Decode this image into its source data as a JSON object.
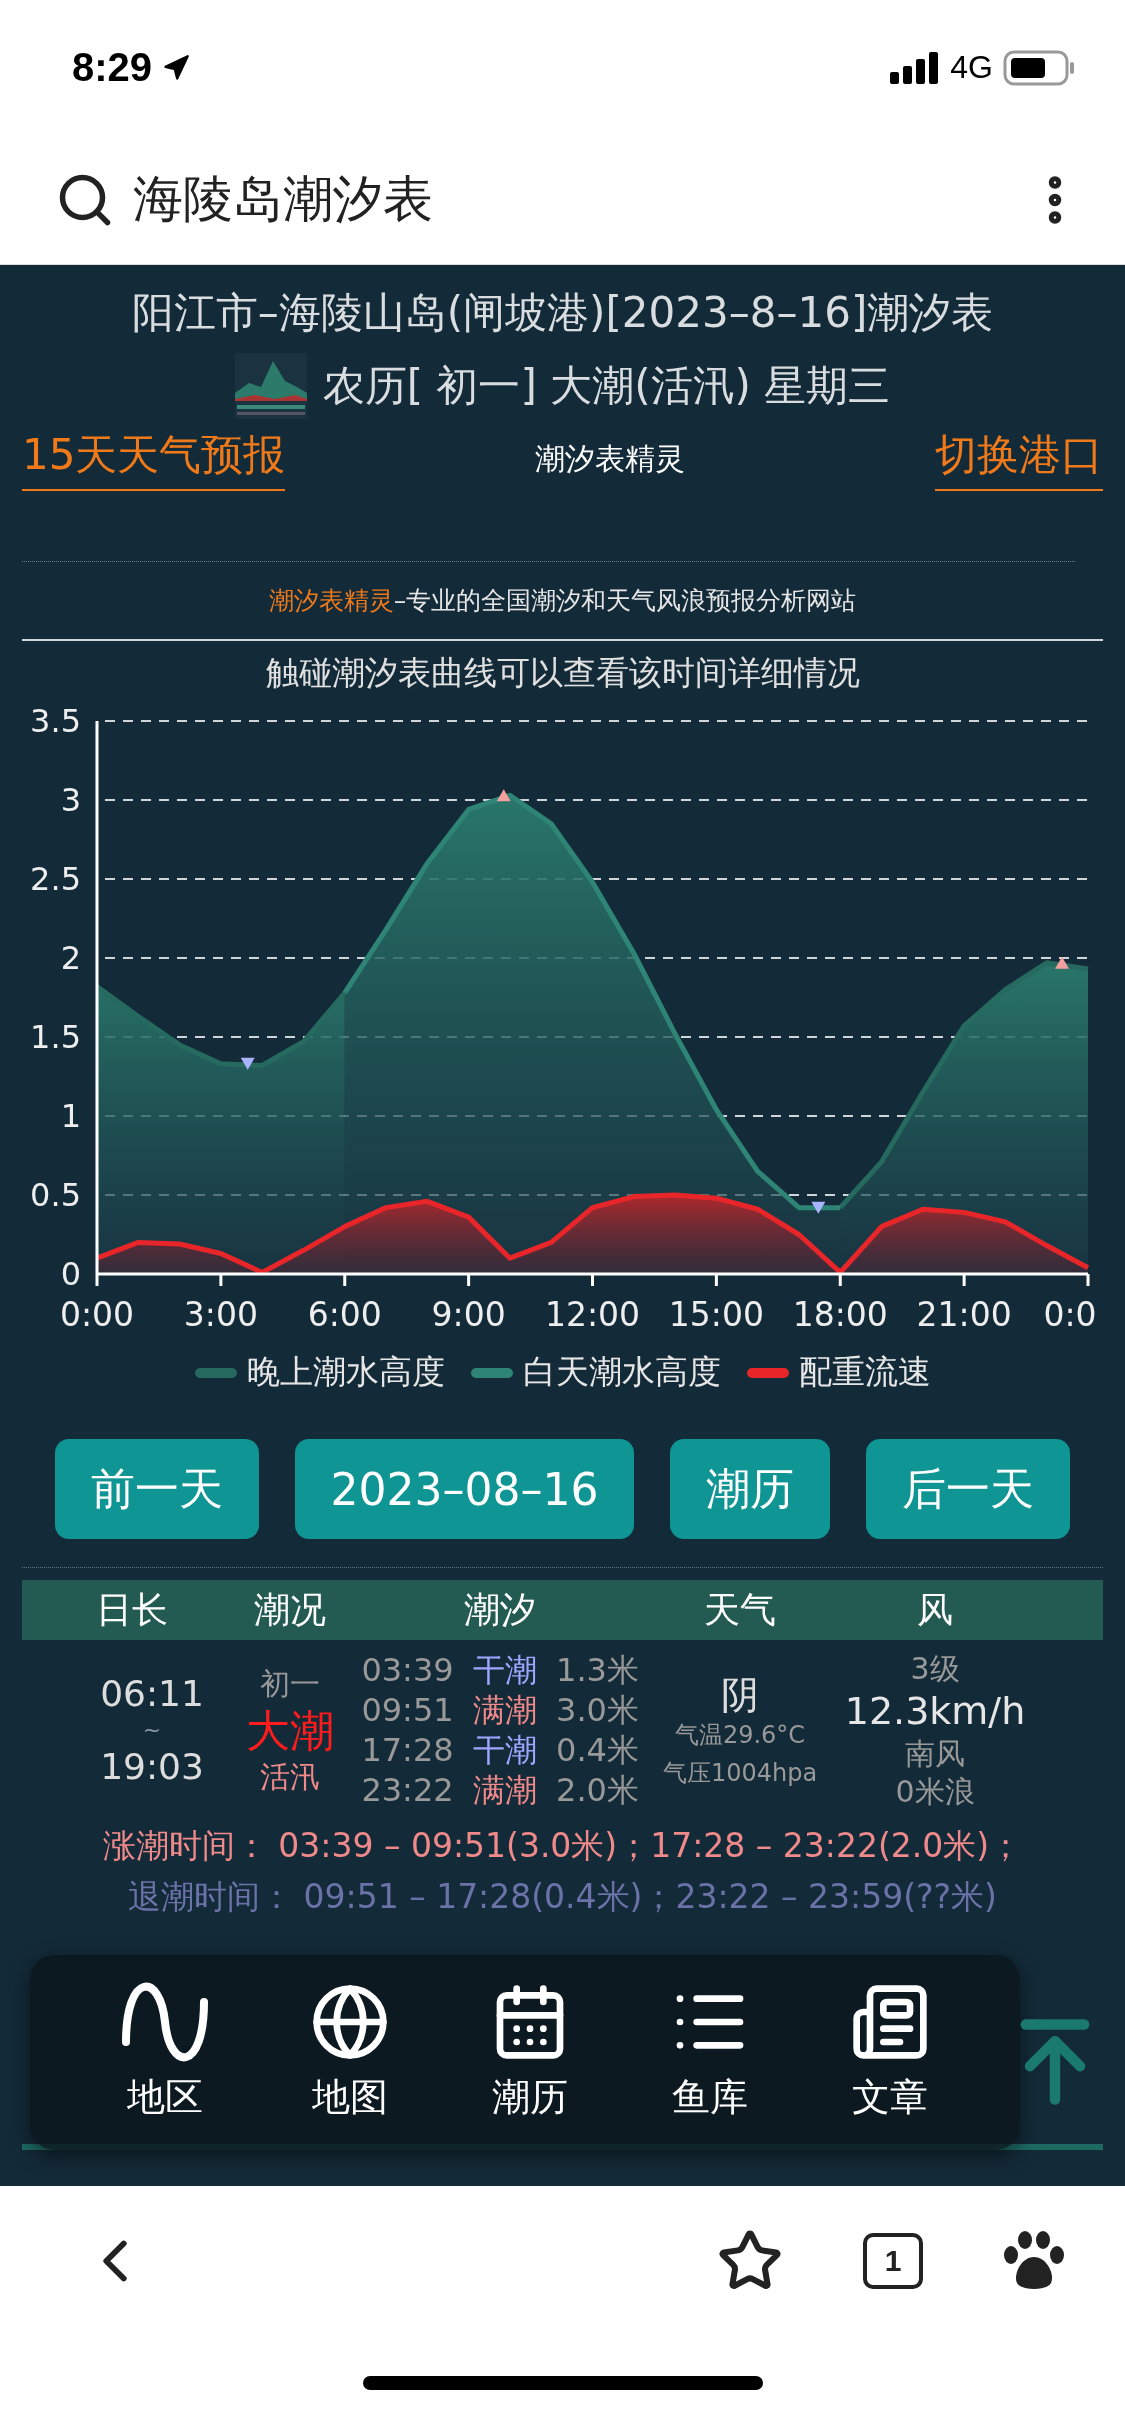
{
  "status_bar": {
    "time": "8:29",
    "network": "4G"
  },
  "search_bar": {
    "query": "海陵岛潮汐表"
  },
  "header": {
    "title": "阳江市–海陵山岛(闸坡港)[2023–8–16]潮汐表",
    "lunar": "农历[ 初一] 大潮(活汛) 星期三",
    "left_link": "15天天气预报",
    "center_label": "潮汐表精灵",
    "right_link": "切换港口",
    "tagline_brand": "潮汐表精灵",
    "tagline_rest": "–专业的全国潮汐和天气风浪预报分析网站"
  },
  "chart": {
    "hint": "触碰潮汐表曲线可以查看该时间详细情况",
    "chart_data": {
      "type": "area",
      "x": [
        0,
        1,
        2,
        3,
        4,
        5,
        6,
        7,
        8,
        9,
        10,
        11,
        12,
        13,
        14,
        15,
        16,
        17,
        18,
        19,
        20,
        21,
        22,
        23,
        24
      ],
      "ylim": [
        0,
        3.5
      ],
      "xlim": [
        0,
        24
      ],
      "grid": true,
      "yticks": [
        0,
        0.5,
        1,
        1.5,
        2,
        2.5,
        3,
        3.5
      ],
      "xticks": [
        {
          "value": 0,
          "label": "0:00"
        },
        {
          "value": 3,
          "label": "3:00"
        },
        {
          "value": 6,
          "label": "6:00"
        },
        {
          "value": 9,
          "label": "9:00"
        },
        {
          "value": 12,
          "label": "12:00"
        },
        {
          "value": 15,
          "label": "15:00"
        },
        {
          "value": 18,
          "label": "18:00"
        },
        {
          "value": 21,
          "label": "21:00"
        },
        {
          "value": 24,
          "label": "0:0"
        }
      ],
      "series": [
        {
          "name": "晚上潮水高度",
          "color": "#26695f",
          "values": [
            1.82,
            1.63,
            1.45,
            1.33,
            1.32,
            1.47,
            1.78,
            null,
            null,
            null,
            null,
            null,
            null,
            null,
            null,
            null,
            null,
            null,
            0.42,
            0.71,
            1.15,
            1.57,
            1.8,
            1.97,
            1.93
          ]
        },
        {
          "name": "白天潮水高度",
          "color": "#2e8575",
          "values": [
            null,
            null,
            null,
            null,
            null,
            null,
            1.78,
            2.18,
            2.6,
            2.94,
            3.03,
            2.85,
            2.48,
            2.03,
            1.52,
            1.04,
            0.65,
            0.42,
            0.42,
            null,
            null,
            null,
            null,
            null,
            null
          ]
        },
        {
          "name": "配重流速",
          "color": "#e8262a",
          "values": [
            0.1,
            0.2,
            0.19,
            0.13,
            0.01,
            0.15,
            0.3,
            0.42,
            0.46,
            0.36,
            0.1,
            0.2,
            0.42,
            0.49,
            0.5,
            0.48,
            0.41,
            0.25,
            0.01,
            0.3,
            0.41,
            0.39,
            0.33,
            0.18,
            0.04
          ]
        }
      ]
    }
  },
  "buttons": [
    {
      "label": "前一天"
    },
    {
      "label": "2023–08–16"
    },
    {
      "label": "潮历"
    },
    {
      "label": "后一天"
    }
  ],
  "table": {
    "columns": [
      "日长",
      "潮况",
      "潮汐",
      "天气",
      "风"
    ],
    "sunrise": "06:11",
    "sun_sep": "~",
    "sunset": "19:03",
    "lunar_day": "初一",
    "tide_level": "大潮",
    "tide_phase": "活汛",
    "tides": [
      {
        "time": "03:39",
        "kind": "low",
        "label": "干潮",
        "height": "1.3米"
      },
      {
        "time": "09:51",
        "kind": "high",
        "label": "满潮",
        "height": "3.0米"
      },
      {
        "time": "17:28",
        "kind": "low",
        "label": "干潮",
        "height": "0.4米"
      },
      {
        "time": "23:22",
        "kind": "high",
        "label": "满潮",
        "height": "2.0米"
      }
    ],
    "weather": "阴",
    "temperature": "气温29.6°C",
    "pressure": "气压1004hpa",
    "wind_level": "3级",
    "wind_speed": "12.3km/h",
    "wind_direction": "南风",
    "wave": "0米浪"
  },
  "rising": "涨潮时间：  03:39 – 09:51(3.0米)；17:28 – 23:22(2.0米)；",
  "falling": "退潮时间：  09:51 – 17:28(0.4米)；23:22 – 23:59(??米)",
  "float_menu": [
    {
      "label": "地区"
    },
    {
      "label": "地图"
    },
    {
      "label": "潮历"
    },
    {
      "label": "鱼库"
    },
    {
      "label": "文章"
    }
  ],
  "browser_bar": {
    "tab_count": "1"
  }
}
